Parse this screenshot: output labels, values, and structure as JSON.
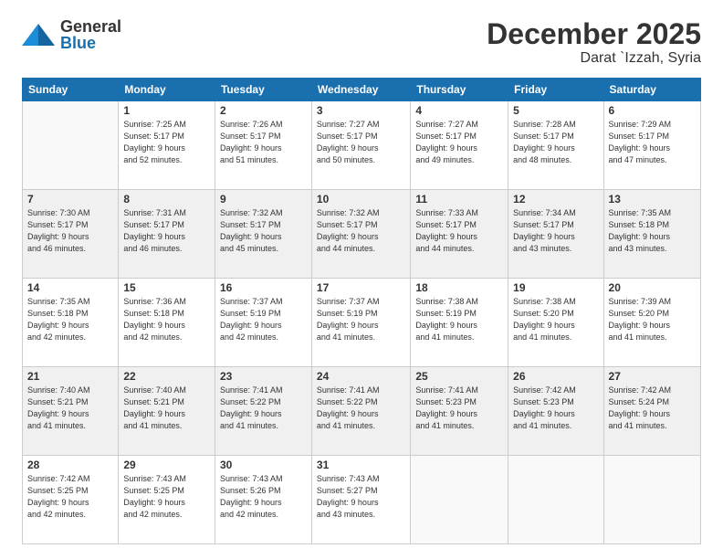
{
  "header": {
    "logo_general": "General",
    "logo_blue": "Blue",
    "month": "December 2025",
    "location": "Darat `Izzah, Syria"
  },
  "days_of_week": [
    "Sunday",
    "Monday",
    "Tuesday",
    "Wednesday",
    "Thursday",
    "Friday",
    "Saturday"
  ],
  "weeks": [
    [
      {
        "day": "",
        "info": ""
      },
      {
        "day": "1",
        "info": "Sunrise: 7:25 AM\nSunset: 5:17 PM\nDaylight: 9 hours\nand 52 minutes."
      },
      {
        "day": "2",
        "info": "Sunrise: 7:26 AM\nSunset: 5:17 PM\nDaylight: 9 hours\nand 51 minutes."
      },
      {
        "day": "3",
        "info": "Sunrise: 7:27 AM\nSunset: 5:17 PM\nDaylight: 9 hours\nand 50 minutes."
      },
      {
        "day": "4",
        "info": "Sunrise: 7:27 AM\nSunset: 5:17 PM\nDaylight: 9 hours\nand 49 minutes."
      },
      {
        "day": "5",
        "info": "Sunrise: 7:28 AM\nSunset: 5:17 PM\nDaylight: 9 hours\nand 48 minutes."
      },
      {
        "day": "6",
        "info": "Sunrise: 7:29 AM\nSunset: 5:17 PM\nDaylight: 9 hours\nand 47 minutes."
      }
    ],
    [
      {
        "day": "7",
        "info": "Sunrise: 7:30 AM\nSunset: 5:17 PM\nDaylight: 9 hours\nand 46 minutes."
      },
      {
        "day": "8",
        "info": "Sunrise: 7:31 AM\nSunset: 5:17 PM\nDaylight: 9 hours\nand 46 minutes."
      },
      {
        "day": "9",
        "info": "Sunrise: 7:32 AM\nSunset: 5:17 PM\nDaylight: 9 hours\nand 45 minutes."
      },
      {
        "day": "10",
        "info": "Sunrise: 7:32 AM\nSunset: 5:17 PM\nDaylight: 9 hours\nand 44 minutes."
      },
      {
        "day": "11",
        "info": "Sunrise: 7:33 AM\nSunset: 5:17 PM\nDaylight: 9 hours\nand 44 minutes."
      },
      {
        "day": "12",
        "info": "Sunrise: 7:34 AM\nSunset: 5:17 PM\nDaylight: 9 hours\nand 43 minutes."
      },
      {
        "day": "13",
        "info": "Sunrise: 7:35 AM\nSunset: 5:18 PM\nDaylight: 9 hours\nand 43 minutes."
      }
    ],
    [
      {
        "day": "14",
        "info": "Sunrise: 7:35 AM\nSunset: 5:18 PM\nDaylight: 9 hours\nand 42 minutes."
      },
      {
        "day": "15",
        "info": "Sunrise: 7:36 AM\nSunset: 5:18 PM\nDaylight: 9 hours\nand 42 minutes."
      },
      {
        "day": "16",
        "info": "Sunrise: 7:37 AM\nSunset: 5:19 PM\nDaylight: 9 hours\nand 42 minutes."
      },
      {
        "day": "17",
        "info": "Sunrise: 7:37 AM\nSunset: 5:19 PM\nDaylight: 9 hours\nand 41 minutes."
      },
      {
        "day": "18",
        "info": "Sunrise: 7:38 AM\nSunset: 5:19 PM\nDaylight: 9 hours\nand 41 minutes."
      },
      {
        "day": "19",
        "info": "Sunrise: 7:38 AM\nSunset: 5:20 PM\nDaylight: 9 hours\nand 41 minutes."
      },
      {
        "day": "20",
        "info": "Sunrise: 7:39 AM\nSunset: 5:20 PM\nDaylight: 9 hours\nand 41 minutes."
      }
    ],
    [
      {
        "day": "21",
        "info": "Sunrise: 7:40 AM\nSunset: 5:21 PM\nDaylight: 9 hours\nand 41 minutes."
      },
      {
        "day": "22",
        "info": "Sunrise: 7:40 AM\nSunset: 5:21 PM\nDaylight: 9 hours\nand 41 minutes."
      },
      {
        "day": "23",
        "info": "Sunrise: 7:41 AM\nSunset: 5:22 PM\nDaylight: 9 hours\nand 41 minutes."
      },
      {
        "day": "24",
        "info": "Sunrise: 7:41 AM\nSunset: 5:22 PM\nDaylight: 9 hours\nand 41 minutes."
      },
      {
        "day": "25",
        "info": "Sunrise: 7:41 AM\nSunset: 5:23 PM\nDaylight: 9 hours\nand 41 minutes."
      },
      {
        "day": "26",
        "info": "Sunrise: 7:42 AM\nSunset: 5:23 PM\nDaylight: 9 hours\nand 41 minutes."
      },
      {
        "day": "27",
        "info": "Sunrise: 7:42 AM\nSunset: 5:24 PM\nDaylight: 9 hours\nand 41 minutes."
      }
    ],
    [
      {
        "day": "28",
        "info": "Sunrise: 7:42 AM\nSunset: 5:25 PM\nDaylight: 9 hours\nand 42 minutes."
      },
      {
        "day": "29",
        "info": "Sunrise: 7:43 AM\nSunset: 5:25 PM\nDaylight: 9 hours\nand 42 minutes."
      },
      {
        "day": "30",
        "info": "Sunrise: 7:43 AM\nSunset: 5:26 PM\nDaylight: 9 hours\nand 42 minutes."
      },
      {
        "day": "31",
        "info": "Sunrise: 7:43 AM\nSunset: 5:27 PM\nDaylight: 9 hours\nand 43 minutes."
      },
      {
        "day": "",
        "info": ""
      },
      {
        "day": "",
        "info": ""
      },
      {
        "day": "",
        "info": ""
      }
    ]
  ]
}
